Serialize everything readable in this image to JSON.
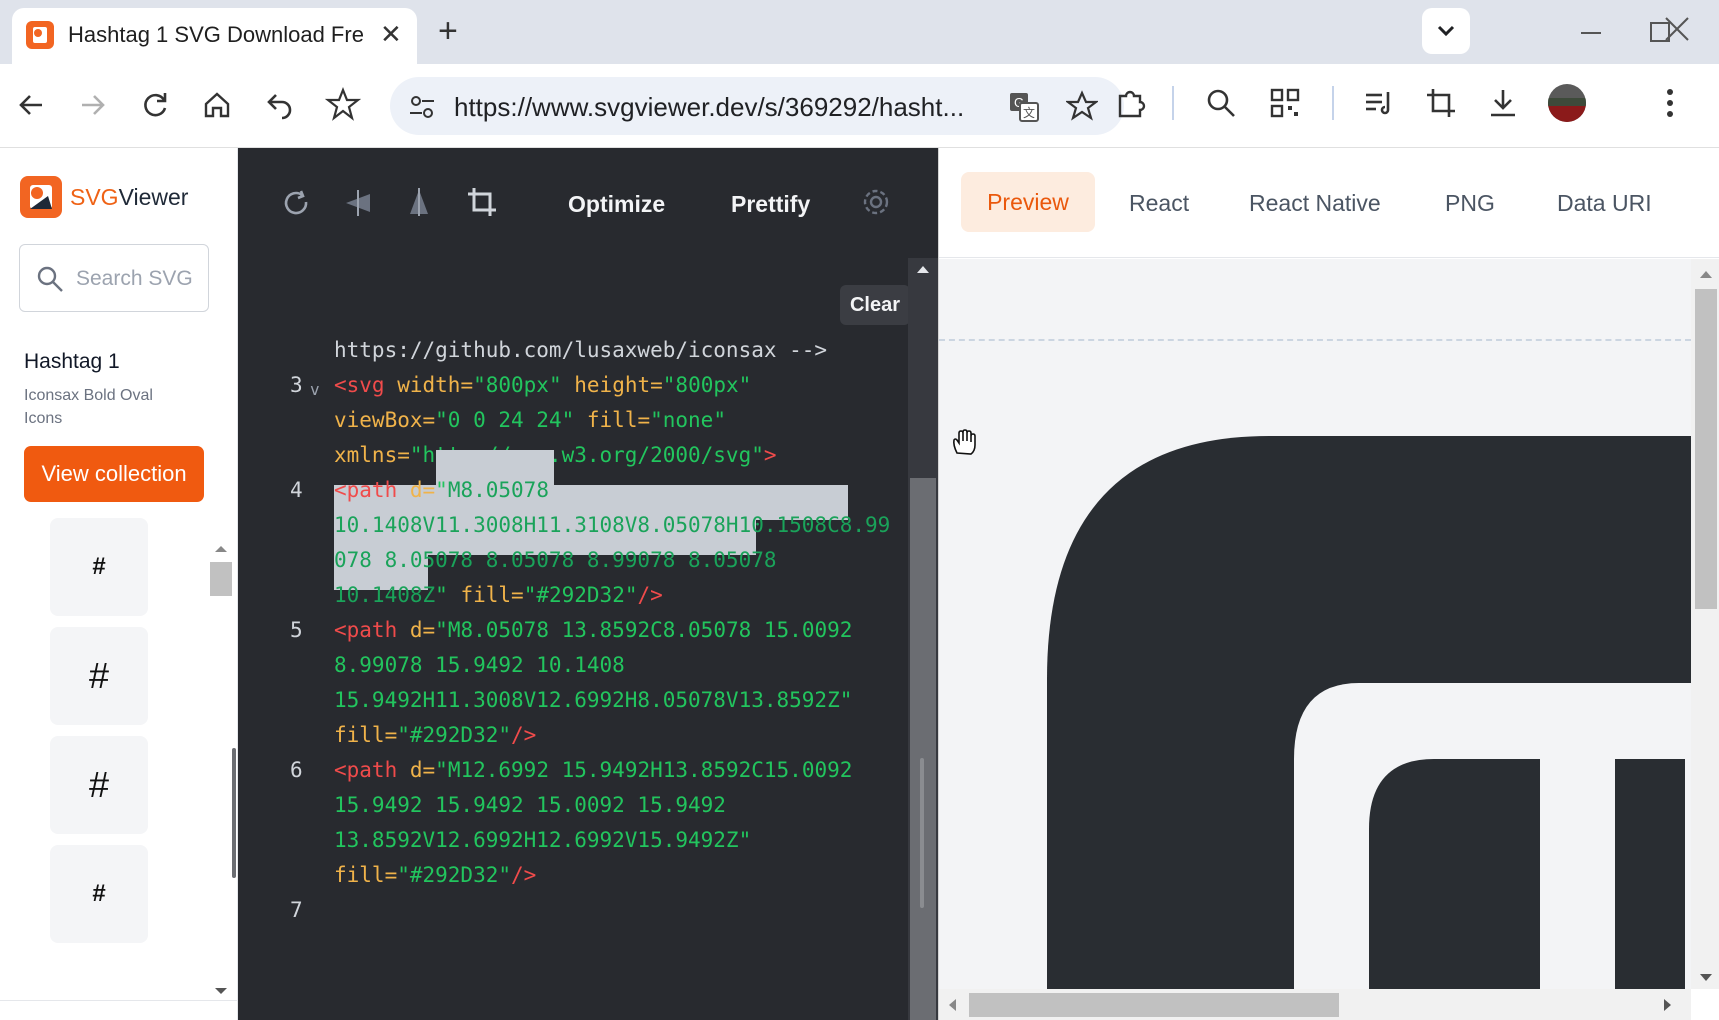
{
  "browser": {
    "tab_title": "Hashtag 1 SVG Download Fre",
    "url": "https://www.svgviewer.dev/s/369292/hasht..."
  },
  "sidebar": {
    "logo_svg": "SVG",
    "logo_viewer": "Viewer",
    "search_placeholder": "Search SVG",
    "icon_title": "Hashtag 1",
    "icon_subtitle": "Iconsax Bold Oval Icons",
    "view_collection": "View collection",
    "thumbs": [
      "#",
      "#",
      "#",
      "#"
    ]
  },
  "editor": {
    "optimize": "Optimize",
    "prettify": "Prettify",
    "clear": "Clear",
    "line_numbers": [
      "3",
      "4",
      "5",
      "6",
      "7"
    ],
    "comment_tail": "https://github.com/lusaxweb/iconsax -->",
    "svg_tag": {
      "open": "<svg",
      "width_attr": "width=",
      "width_val": "\"800px\"",
      "height_attr": "height=",
      "height_val": "\"800px\"",
      "viewbox_attr": "viewBox=",
      "viewbox_val": "\"0 0 24 24\"",
      "fill_attr": "fill=",
      "fill_val": "\"none\"",
      "xmlns_attr": "xmlns=",
      "xmlns_val": "\"http://www.w3.org/2000/svg\"",
      "close": ">"
    },
    "path_open": "<path",
    "d_attr": "d=",
    "fill_attr": "fill=",
    "fill_val": "\"#292D32\"",
    "self_close": "/>",
    "quote": "\"",
    "path1": [
      "M8.05078",
      "10.1408V11.3008H11.3108V8.05078H10.1508C8.99",
      "078 8.05078 8.05078 8.99078 8.05078",
      "10.1408Z"
    ],
    "path2": [
      "\"M8.05078 13.8592C8.05078 15.0092",
      "8.99078 15.9492 10.1408",
      "15.9492H11.3008V12.6992H8.05078V13.8592Z\""
    ],
    "path3": [
      "\"M12.6992 15.9492H13.8592C15.0092",
      "15.9492 15.9492 15.0092 15.9492",
      "13.8592V12.6992H12.6992V15.9492Z\""
    ],
    "fold_marker": "v"
  },
  "preview": {
    "tabs": [
      "Preview",
      "React",
      "React Native",
      "PNG",
      "Data URI"
    ],
    "active_tab": "Preview",
    "shape_color": "#292D32"
  }
}
